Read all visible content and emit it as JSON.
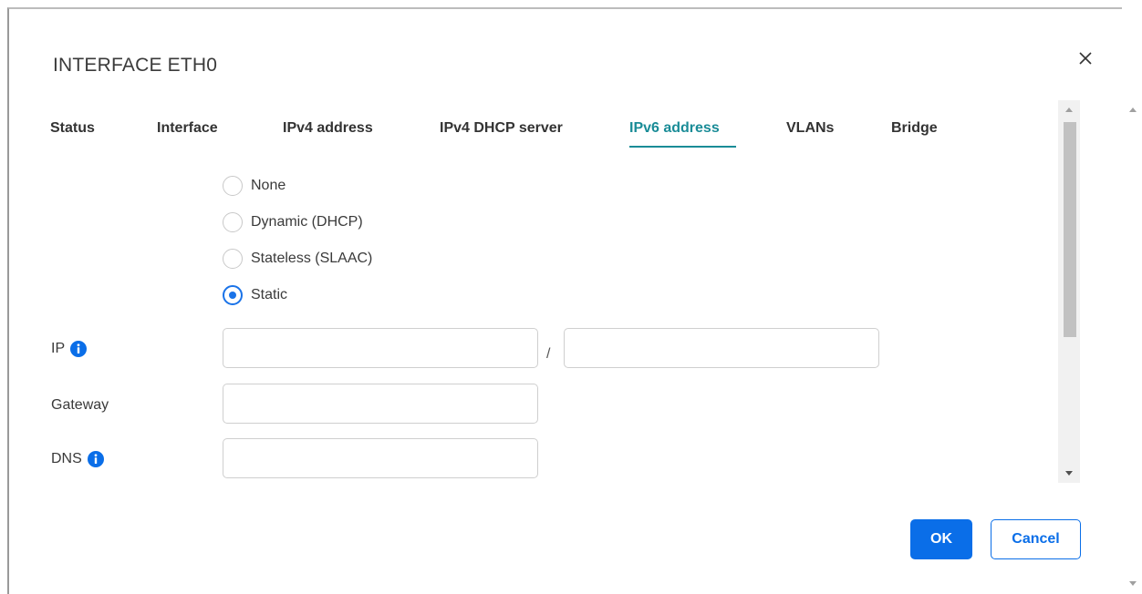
{
  "dialog": {
    "title": "INTERFACE ETH0"
  },
  "tabs": [
    {
      "label": "Status"
    },
    {
      "label": "Interface"
    },
    {
      "label": "IPv4 address"
    },
    {
      "label": "IPv4 DHCP server"
    },
    {
      "label": "IPv6 address",
      "active": true
    },
    {
      "label": "VLANs"
    },
    {
      "label": "Bridge"
    }
  ],
  "mode_options": [
    {
      "label": "None",
      "checked": false
    },
    {
      "label": "Dynamic (DHCP)",
      "checked": false
    },
    {
      "label": "Stateless (SLAAC)",
      "checked": false
    },
    {
      "label": "Static",
      "checked": true
    }
  ],
  "fields": {
    "ip": {
      "label": "IP",
      "value": "",
      "prefix_value": "",
      "separator": "/"
    },
    "gateway": {
      "label": "Gateway",
      "value": ""
    },
    "dns": {
      "label": "DNS",
      "value": ""
    }
  },
  "buttons": {
    "ok": "OK",
    "cancel": "Cancel"
  },
  "colors": {
    "accent_tab": "#1a8c97",
    "primary": "#0a6ee8",
    "radio": "#1a73e8"
  },
  "icons": {
    "close": "close-icon",
    "info": "info-icon"
  }
}
